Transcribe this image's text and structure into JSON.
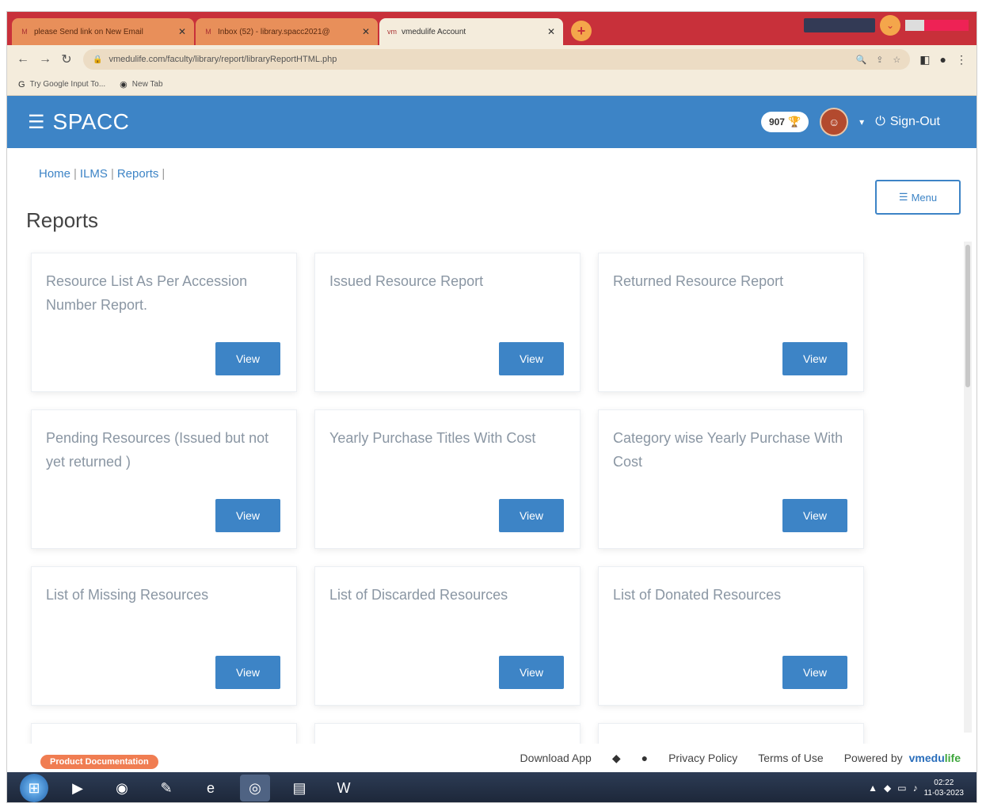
{
  "browser": {
    "tabs": [
      {
        "label": "please Send link on New Email",
        "favicon": "M"
      },
      {
        "label": "Inbox (52) - library.spacc2021@",
        "favicon": "M"
      },
      {
        "label": "vmedulife Account",
        "favicon": "vm"
      }
    ],
    "new_tab_symbol": "+",
    "url": "vmedulife.com/faculty/library/report/libraryReportHTML.php",
    "bookmarks": [
      {
        "label": "Try Google Input To...",
        "icon": "google-g-icon"
      },
      {
        "label": "New Tab",
        "icon": "globe-icon"
      }
    ]
  },
  "header": {
    "brand": "SPACC",
    "points": "907",
    "signout_label": "Sign-Out"
  },
  "breadcrumb": {
    "items": [
      "Home",
      "ILMS",
      "Reports"
    ]
  },
  "menu_label": "Menu",
  "page_title": "Reports",
  "reports": [
    {
      "title": "Resource List As Per Accession Number Report.",
      "button": "View"
    },
    {
      "title": "Issued Resource Report",
      "button": "View"
    },
    {
      "title": "Returned Resource Report",
      "button": "View"
    },
    {
      "title": "Pending Resources (Issued but not yet returned )",
      "button": "View"
    },
    {
      "title": "Yearly Purchase Titles With Cost",
      "button": "View"
    },
    {
      "title": "Category wise Yearly Purchase With Cost",
      "button": "View"
    },
    {
      "title": "List of Missing Resources",
      "button": "View"
    },
    {
      "title": "List of Discarded Resources",
      "button": "View"
    },
    {
      "title": "List of Donated Resources",
      "button": "View"
    }
  ],
  "footer": {
    "product_doc": "Product Documentation",
    "download_app": "Download App",
    "privacy": "Privacy Policy",
    "terms": "Terms of Use",
    "powered_by": "Powered by",
    "powered_brand_a": "vmedu",
    "powered_brand_b": "life"
  },
  "taskbar": {
    "time": "02:22",
    "date": "11-03-2023"
  },
  "colors": {
    "primary": "#3d84c6",
    "tabbar": "#c8303a",
    "card_text": "#8a96a3"
  }
}
